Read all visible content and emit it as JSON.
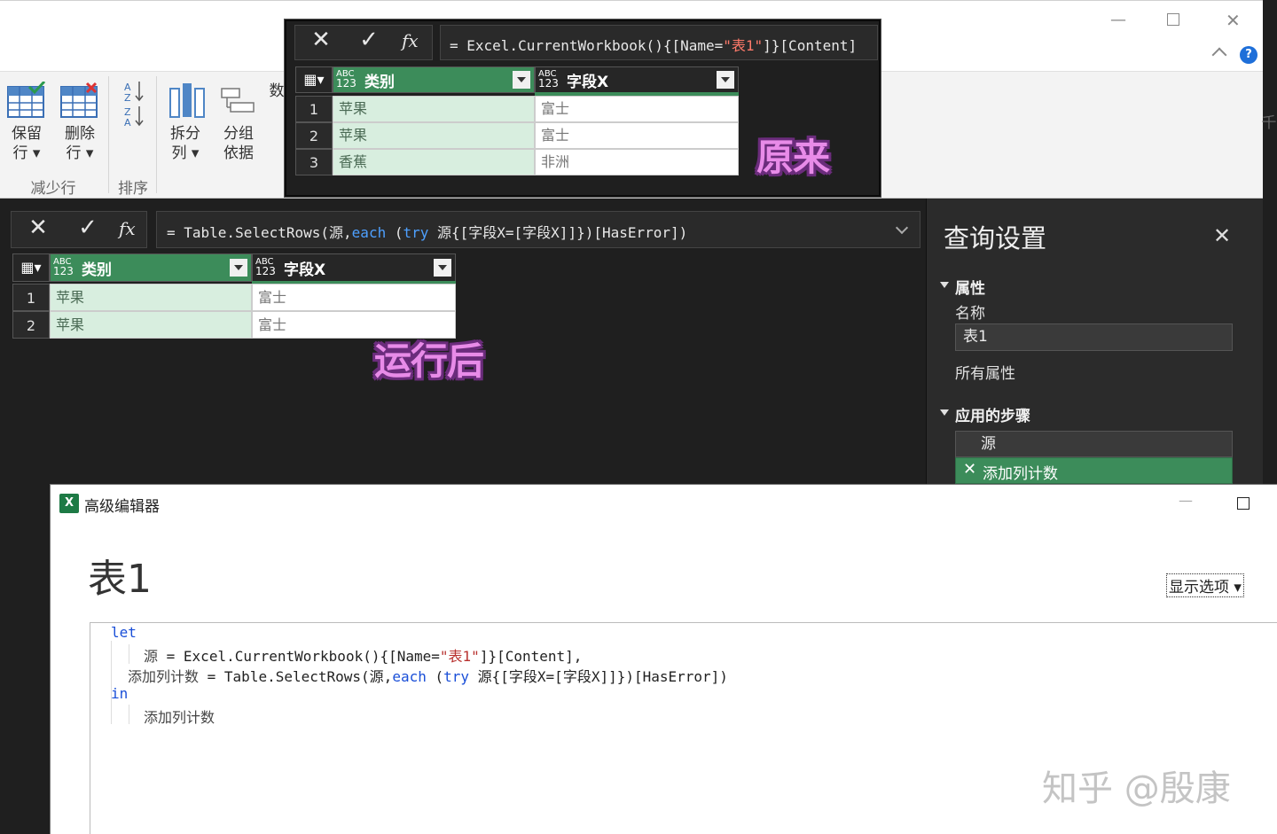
{
  "ribbon": {
    "keep_rows": [
      "保留",
      "行"
    ],
    "remove_rows": [
      "删除",
      "行"
    ],
    "reduce_rows_group": "减少行",
    "sort_group": "排序",
    "split_column": [
      "拆分",
      "列"
    ],
    "group_by": [
      "分组",
      "依据"
    ],
    "data_type_partial": "数",
    "right_edge_partial": "千",
    "help_label": "?"
  },
  "main": {
    "formula": {
      "prefix": "= Table.SelectRows(源,",
      "kw_each": "each",
      "mid1": " (",
      "kw_try": "try",
      "rest": " 源{[字段X=[字段X]]})[HasError])"
    },
    "columns": [
      {
        "type_top": "ABC",
        "type_bottom": "123",
        "name": "类别"
      },
      {
        "type_top": "ABC",
        "type_bottom": "123",
        "name": "字段X"
      }
    ],
    "rows": [
      {
        "n": "1",
        "c1": "苹果",
        "c2": "富士"
      },
      {
        "n": "2",
        "c1": "苹果",
        "c2": "富士"
      }
    ],
    "stamp": "运行后"
  },
  "original": {
    "formula": {
      "prefix": "= Excel.CurrentWorkbook(){[Name=",
      "str": "\"表1\"",
      "suffix": "]}[Content]"
    },
    "columns": [
      {
        "type_top": "ABC",
        "type_bottom": "123",
        "name": "类别"
      },
      {
        "type_top": "ABC",
        "type_bottom": "123",
        "name": "字段X"
      }
    ],
    "rows": [
      {
        "n": "1",
        "c1": "苹果",
        "c2": "富士"
      },
      {
        "n": "2",
        "c1": "苹果",
        "c2": "富士"
      },
      {
        "n": "3",
        "c1": "香蕉",
        "c2": "非洲"
      }
    ],
    "stamp": "原来"
  },
  "query_settings": {
    "title": "查询设置",
    "properties_section": "属性",
    "name_label": "名称",
    "name_value": "表1",
    "all_properties": "所有属性",
    "steps_section": "应用的步骤",
    "steps": [
      "源",
      "添加列计数"
    ]
  },
  "advanced_editor": {
    "window_title": "高级编辑器",
    "query_name": "表1",
    "display_options": "显示选项",
    "code": {
      "let": "let",
      "line2_name": "源",
      "line2_a": " = Excel.CurrentWorkbook(){[Name=",
      "line2_str": "\"表1\"",
      "line2_b": "]}[Content],",
      "line3_name": "添加列计数",
      "line3_a": " = Table.SelectRows(源,",
      "line3_each": "each",
      "line3_b": " (",
      "line3_try": "try",
      "line3_c": " 源{[字段X=[字段X]]})[HasError])",
      "in": "in",
      "line5": "添加列计数"
    },
    "watermark": "知乎 @殷康"
  }
}
